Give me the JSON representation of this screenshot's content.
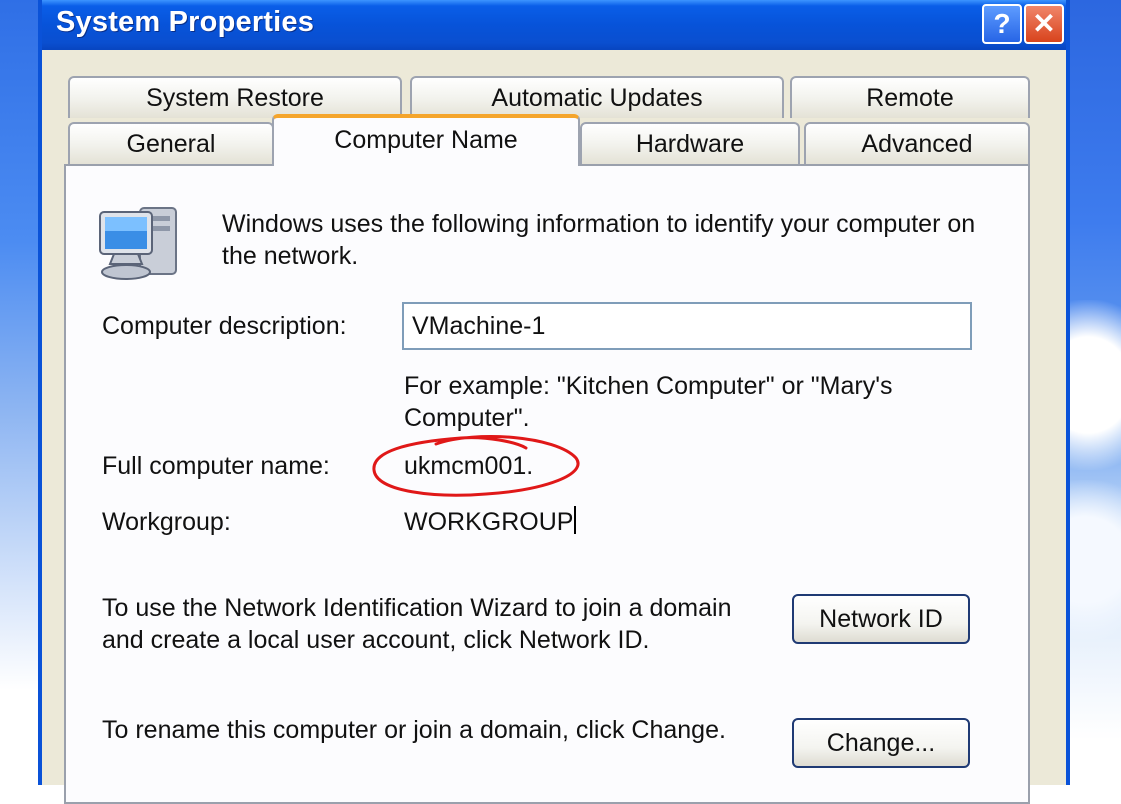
{
  "window": {
    "title": "System Properties"
  },
  "titlebar_buttons": {
    "help_glyph": "?",
    "close_glyph": "✕"
  },
  "tabs_back": [
    "System Restore",
    "Automatic Updates",
    "Remote"
  ],
  "tabs_front": [
    "General",
    "Computer Name",
    "Hardware",
    "Advanced"
  ],
  "active_tab": "Computer Name",
  "panel": {
    "intro_text": "Windows uses the following information to identify your computer on the network.",
    "description_label": "Computer description:",
    "description_value": "VMachine-1",
    "example_text": "For example: \"Kitchen Computer\" or \"Mary's Computer\".",
    "full_name_label": "Full computer name:",
    "full_name_value": "ukmcm001.",
    "workgroup_label": "Workgroup:",
    "workgroup_value": "WORKGROUP",
    "network_id_text": "To use the Network Identification Wizard to join a domain and create a local user account, click Network ID.",
    "network_id_button": "Network ID",
    "rename_text": "To rename this computer or join a domain, click Change.",
    "change_button": "Change..."
  },
  "icons": {
    "computer": "computer-icon"
  },
  "colors": {
    "titlebar": "#0a52d8",
    "active_tab_accent": "#f5a52c",
    "annotation": "#e01818"
  }
}
